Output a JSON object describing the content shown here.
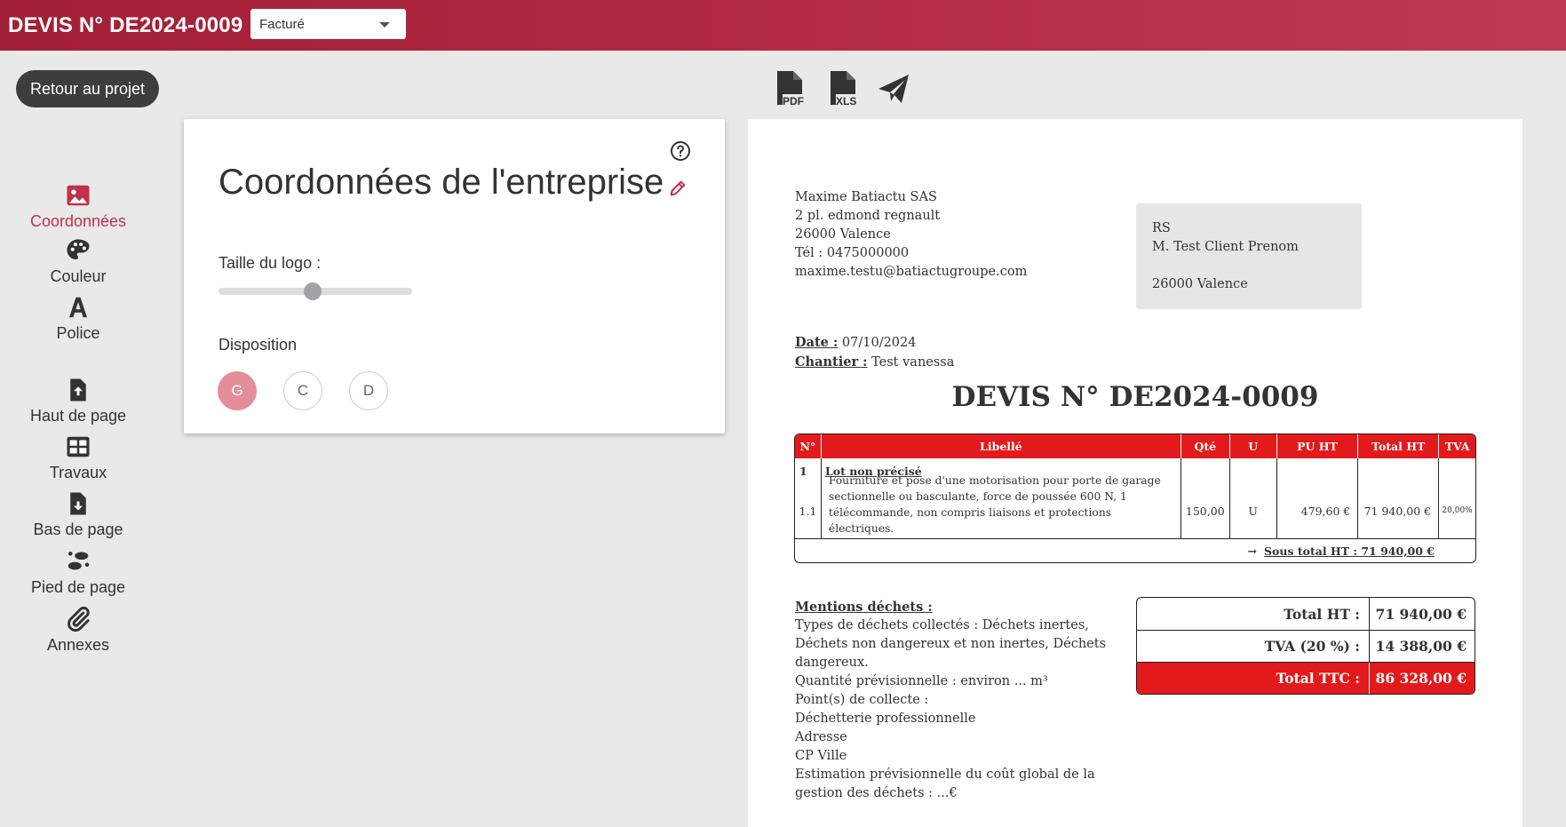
{
  "header": {
    "title": "DEVIS N° DE2024-0009",
    "status_value": "Facturé"
  },
  "back_button": "Retour au projet",
  "sidebar": {
    "items": [
      {
        "label": "Coordonnées",
        "icon": "image-icon"
      },
      {
        "label": "Couleur",
        "icon": "palette-icon"
      },
      {
        "label": "Police",
        "icon": "font-icon"
      },
      {
        "label": "Haut de page",
        "icon": "file-upload-icon"
      },
      {
        "label": "Travaux",
        "icon": "table-icon"
      },
      {
        "label": "Bas de page",
        "icon": "file-download-icon"
      },
      {
        "label": "Pied de page",
        "icon": "footprints-icon"
      },
      {
        "label": "Annexes",
        "icon": "paperclip-icon"
      }
    ]
  },
  "card": {
    "title": "Coordonnées de l'entreprise",
    "logo_size_label": "Taille du logo :",
    "logo_size_level": 0.49,
    "disposition_label": "Disposition",
    "disposition_options": [
      "G",
      "C",
      "D"
    ],
    "disposition_selected": "G"
  },
  "actions": {
    "pdf": "PDF",
    "xls": "XLS"
  },
  "colors": {
    "brand": "#a11f36",
    "accent": "#e31a1c",
    "active": "#c0314a"
  },
  "document": {
    "company": [
      "Maxime Batiactu SAS",
      "2 pl. edmond regnault",
      "26000 Valence",
      "Tél : 0475000000",
      "maxime.testu@batiactugroupe.com"
    ],
    "client": [
      "RS",
      "M. Test Client Prenom",
      "",
      "26000 Valence"
    ],
    "date_label": "Date :",
    "date_value": "07/10/2024",
    "site_label": "Chantier :",
    "site_value": "Test vanessa",
    "title": "DEVIS N° DE2024-0009",
    "table": {
      "headers": [
        "N°",
        "Libellé",
        "Qté",
        "U",
        "PU HT",
        "Total HT",
        "TVA"
      ],
      "lot": {
        "num": "1",
        "label": "Lot non précisé"
      },
      "item": {
        "num": "1.1",
        "label": "Fourniture et pose d'une motorisation pour porte de garage sectionnelle ou basculante, force de poussée 600 N, 1 télécommande, non compris liaisons et protections électriques.",
        "qty": "150,00",
        "unit": "U",
        "pu": "479,60 €",
        "total": "71 940,00 €",
        "tva": "20,00%"
      },
      "subtotal": "Sous total HT : 71 940,00 €"
    },
    "waste": {
      "title": "Mentions déchets :",
      "lines": [
        "Types de déchets collectés : Déchets inertes, Déchets non dangereux et non inertes, Déchets dangereux.",
        "Quantité prévisionnelle : environ ... m³",
        "Point(s) de collecte :",
        "Déchetterie professionnelle",
        "Adresse",
        "CP Ville",
        "Estimation prévisionnelle du coût global de la gestion des déchets : ...€"
      ]
    },
    "totals": [
      {
        "label": "Total HT :",
        "value": "71 940,00 €"
      },
      {
        "label": "TVA (20 %) :",
        "value": "14 388,00 €"
      },
      {
        "label": "Total TTC :",
        "value": "86 328,00 €"
      }
    ]
  }
}
